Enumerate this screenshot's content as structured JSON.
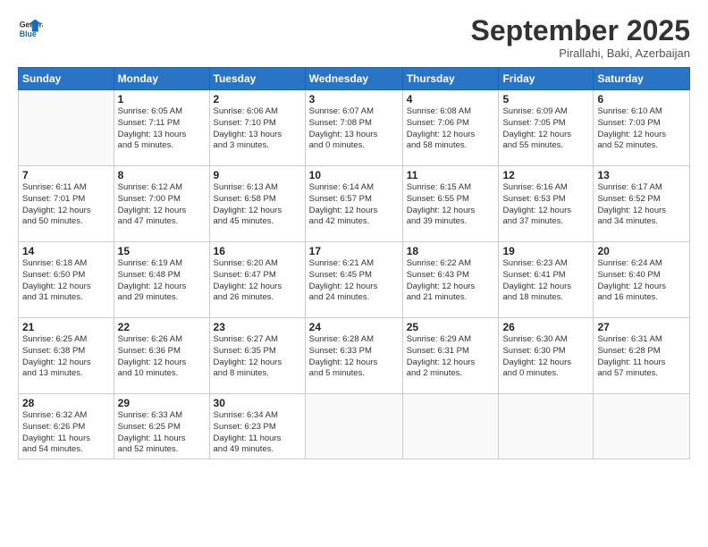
{
  "logo": {
    "line1": "General",
    "line2": "Blue"
  },
  "title": "September 2025",
  "subtitle": "Pirallahi, Baki, Azerbaijan",
  "days_of_week": [
    "Sunday",
    "Monday",
    "Tuesday",
    "Wednesday",
    "Thursday",
    "Friday",
    "Saturday"
  ],
  "weeks": [
    [
      {
        "day": "",
        "info": ""
      },
      {
        "day": "1",
        "info": "Sunrise: 6:05 AM\nSunset: 7:11 PM\nDaylight: 13 hours\nand 5 minutes."
      },
      {
        "day": "2",
        "info": "Sunrise: 6:06 AM\nSunset: 7:10 PM\nDaylight: 13 hours\nand 3 minutes."
      },
      {
        "day": "3",
        "info": "Sunrise: 6:07 AM\nSunset: 7:08 PM\nDaylight: 13 hours\nand 0 minutes."
      },
      {
        "day": "4",
        "info": "Sunrise: 6:08 AM\nSunset: 7:06 PM\nDaylight: 12 hours\nand 58 minutes."
      },
      {
        "day": "5",
        "info": "Sunrise: 6:09 AM\nSunset: 7:05 PM\nDaylight: 12 hours\nand 55 minutes."
      },
      {
        "day": "6",
        "info": "Sunrise: 6:10 AM\nSunset: 7:03 PM\nDaylight: 12 hours\nand 52 minutes."
      }
    ],
    [
      {
        "day": "7",
        "info": "Sunrise: 6:11 AM\nSunset: 7:01 PM\nDaylight: 12 hours\nand 50 minutes."
      },
      {
        "day": "8",
        "info": "Sunrise: 6:12 AM\nSunset: 7:00 PM\nDaylight: 12 hours\nand 47 minutes."
      },
      {
        "day": "9",
        "info": "Sunrise: 6:13 AM\nSunset: 6:58 PM\nDaylight: 12 hours\nand 45 minutes."
      },
      {
        "day": "10",
        "info": "Sunrise: 6:14 AM\nSunset: 6:57 PM\nDaylight: 12 hours\nand 42 minutes."
      },
      {
        "day": "11",
        "info": "Sunrise: 6:15 AM\nSunset: 6:55 PM\nDaylight: 12 hours\nand 39 minutes."
      },
      {
        "day": "12",
        "info": "Sunrise: 6:16 AM\nSunset: 6:53 PM\nDaylight: 12 hours\nand 37 minutes."
      },
      {
        "day": "13",
        "info": "Sunrise: 6:17 AM\nSunset: 6:52 PM\nDaylight: 12 hours\nand 34 minutes."
      }
    ],
    [
      {
        "day": "14",
        "info": "Sunrise: 6:18 AM\nSunset: 6:50 PM\nDaylight: 12 hours\nand 31 minutes."
      },
      {
        "day": "15",
        "info": "Sunrise: 6:19 AM\nSunset: 6:48 PM\nDaylight: 12 hours\nand 29 minutes."
      },
      {
        "day": "16",
        "info": "Sunrise: 6:20 AM\nSunset: 6:47 PM\nDaylight: 12 hours\nand 26 minutes."
      },
      {
        "day": "17",
        "info": "Sunrise: 6:21 AM\nSunset: 6:45 PM\nDaylight: 12 hours\nand 24 minutes."
      },
      {
        "day": "18",
        "info": "Sunrise: 6:22 AM\nSunset: 6:43 PM\nDaylight: 12 hours\nand 21 minutes."
      },
      {
        "day": "19",
        "info": "Sunrise: 6:23 AM\nSunset: 6:41 PM\nDaylight: 12 hours\nand 18 minutes."
      },
      {
        "day": "20",
        "info": "Sunrise: 6:24 AM\nSunset: 6:40 PM\nDaylight: 12 hours\nand 16 minutes."
      }
    ],
    [
      {
        "day": "21",
        "info": "Sunrise: 6:25 AM\nSunset: 6:38 PM\nDaylight: 12 hours\nand 13 minutes."
      },
      {
        "day": "22",
        "info": "Sunrise: 6:26 AM\nSunset: 6:36 PM\nDaylight: 12 hours\nand 10 minutes."
      },
      {
        "day": "23",
        "info": "Sunrise: 6:27 AM\nSunset: 6:35 PM\nDaylight: 12 hours\nand 8 minutes."
      },
      {
        "day": "24",
        "info": "Sunrise: 6:28 AM\nSunset: 6:33 PM\nDaylight: 12 hours\nand 5 minutes."
      },
      {
        "day": "25",
        "info": "Sunrise: 6:29 AM\nSunset: 6:31 PM\nDaylight: 12 hours\nand 2 minutes."
      },
      {
        "day": "26",
        "info": "Sunrise: 6:30 AM\nSunset: 6:30 PM\nDaylight: 12 hours\nand 0 minutes."
      },
      {
        "day": "27",
        "info": "Sunrise: 6:31 AM\nSunset: 6:28 PM\nDaylight: 11 hours\nand 57 minutes."
      }
    ],
    [
      {
        "day": "28",
        "info": "Sunrise: 6:32 AM\nSunset: 6:26 PM\nDaylight: 11 hours\nand 54 minutes."
      },
      {
        "day": "29",
        "info": "Sunrise: 6:33 AM\nSunset: 6:25 PM\nDaylight: 11 hours\nand 52 minutes."
      },
      {
        "day": "30",
        "info": "Sunrise: 6:34 AM\nSunset: 6:23 PM\nDaylight: 11 hours\nand 49 minutes."
      },
      {
        "day": "",
        "info": ""
      },
      {
        "day": "",
        "info": ""
      },
      {
        "day": "",
        "info": ""
      },
      {
        "day": "",
        "info": ""
      }
    ]
  ]
}
